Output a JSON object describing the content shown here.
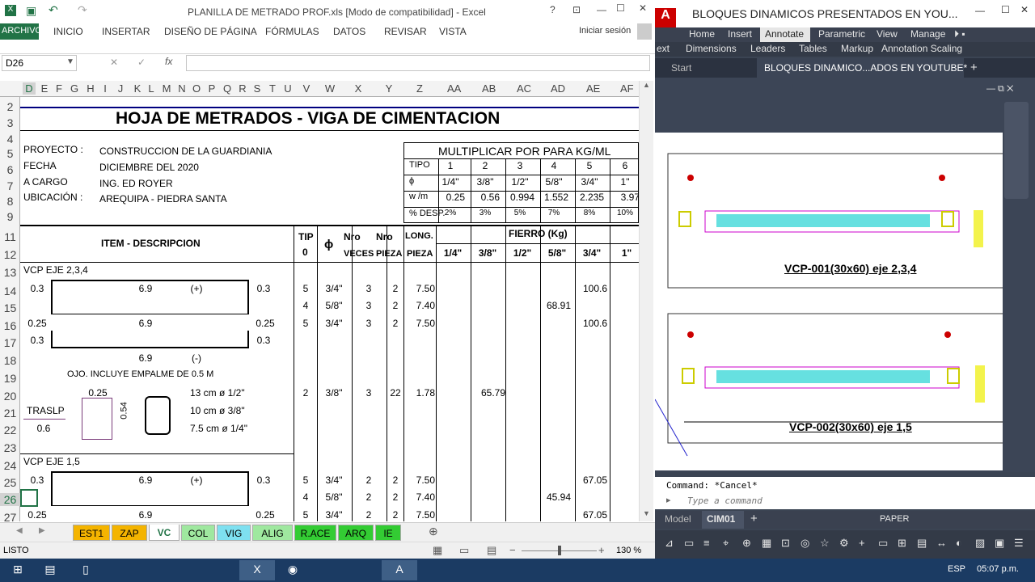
{
  "excel": {
    "title": "PLANILLA DE METRADO PROF.xls  [Modo de compatibilidad] - Excel",
    "tabs": [
      "ARCHIVO",
      "INICIO",
      "INSERTAR",
      "DISEÑO DE PÁGINA",
      "FÓRMULAS",
      "DATOS",
      "REVISAR",
      "VISTA"
    ],
    "signin": "Iniciar sesión",
    "namebox": "D26",
    "columns": [
      "D",
      "E",
      "F",
      "G",
      "H",
      "I",
      "J",
      "K",
      "L",
      "M",
      "N",
      "O",
      "P",
      "Q",
      "R",
      "S",
      "T",
      "U",
      "V",
      "W",
      "X",
      "Y",
      "Z",
      "AA",
      "AB",
      "AC",
      "AD",
      "AE",
      "AF"
    ],
    "rows": [
      "2",
      "3",
      "4",
      "5",
      "6",
      "7",
      "8",
      "9",
      "11",
      "12",
      "13",
      "14",
      "15",
      "16",
      "17",
      "18",
      "19",
      "20",
      "21",
      "22",
      "23",
      "24",
      "25",
      "26",
      "27"
    ],
    "sheet_title": "HOJA DE METRADOS - VIGA DE CIMENTACION",
    "info": {
      "labels": [
        "PROYECTO :",
        "FECHA",
        "A CARGO",
        "UBICACIÓN :"
      ],
      "values": [
        "CONSTRUCCION DE LA GUARDIANIA",
        "DICIEMBRE DEL 2020",
        "ING. ED ROYER",
        "AREQUIPA - PIEDRA SANTA"
      ]
    },
    "mult": {
      "title": "MULTIPLICAR POR PARA  KG/ML",
      "tipo_label": "TIPO",
      "tipos": [
        "1",
        "2",
        "3",
        "4",
        "5",
        "6"
      ],
      "phi_label": "ϕ",
      "phis": [
        "1/4\"",
        "3/8\"",
        "1/2\"",
        "5/8\"",
        "3/4\"",
        "1\""
      ],
      "wm_label": "w /m",
      "wm": [
        "0.25",
        "0.56",
        "0.994",
        "1.552",
        "2.235",
        "3.97"
      ],
      "desp_label": "% DESP.",
      "desp": [
        "2%",
        "3%",
        "5%",
        "7%",
        "8%",
        "10%"
      ]
    },
    "head": {
      "item": "ITEM - DESCRIPCION",
      "tip": "TIP",
      "tip0": "0",
      "phi": "ϕ",
      "nro1": "Nro",
      "veces": "VECES",
      "nro2": "Nro",
      "pieza": "PIEZA",
      "long": "LONG.",
      "piezal": "PIEZA",
      "fierro": "FIERRO (Kg)",
      "bars": [
        "1/4\"",
        "3/8\"",
        "1/2\"",
        "5/8\"",
        "3/4\"",
        "1\""
      ]
    },
    "body": {
      "r13": "VCP EJE 2,3,4",
      "r14": [
        "0.3",
        "6.9",
        "(+)",
        "0.3",
        "5",
        "3/4\"",
        "3",
        "2",
        "7.50",
        "100.6"
      ],
      "r15": [
        "4",
        "5/8\"",
        "3",
        "2",
        "7.40",
        "68.91"
      ],
      "r16": [
        "0.25",
        "6.9",
        "0.25",
        "5",
        "3/4\"",
        "3",
        "2",
        "7.50",
        "100.6"
      ],
      "r17": [
        "0.3",
        "0.3"
      ],
      "r18": [
        "6.9",
        "(-)"
      ],
      "r19": "OJO. INCLUYE EMPALME DE 0.5 M",
      "r20": [
        "0.25",
        "13 cm  ø 1/2\"",
        "2",
        "3/8\"",
        "3",
        "22",
        "1.78",
        "65.79"
      ],
      "r21": [
        "TRASLP",
        "0.54",
        "10 cm  ø 3/8\""
      ],
      "r22": [
        "0.6",
        "7.5 cm  ø 1/4\""
      ],
      "r24": "VCP EJE 1,5",
      "r25": [
        "0.3",
        "6.9",
        "(+)",
        "0.3",
        "5",
        "3/4\"",
        "2",
        "2",
        "7.50",
        "67.05"
      ],
      "r26": [
        "4",
        "5/8\"",
        "2",
        "2",
        "7.40",
        "45.94"
      ],
      "r27": [
        "0.25",
        "6.9",
        "0.25",
        "5",
        "3/4\"",
        "2",
        "2",
        "7.50",
        "67.05"
      ]
    },
    "sheets": [
      "EST1",
      "ZAP",
      "VC",
      "COL",
      "VIG",
      "ALIG",
      "R.ACE",
      "ARQ",
      "IE"
    ],
    "status": "LISTO",
    "zoom": "130 %"
  },
  "autocad": {
    "title": "BLOQUES DINAMICOS PRESENTADOS EN YOU...",
    "tabs": [
      "Home",
      "Insert",
      "Annotate",
      "Parametric",
      "View",
      "Manage"
    ],
    "panels": [
      "ext",
      "Dimensions",
      "Leaders",
      "Tables",
      "Markup",
      "Annotation Scaling"
    ],
    "doctabs": [
      "Start",
      "BLOQUES DINAMICO...ADOS EN YOUTUBE*"
    ],
    "label1": "VCP-001(30x60) eje 2,3,4",
    "label2": "VCP-002(30x60) eje 1,5",
    "cmd_history": "Command: *Cancel*",
    "cmd_placeholder": "Type a command",
    "layouts": [
      "Model",
      "CIM01"
    ],
    "paper": "PAPER"
  },
  "taskbar": {
    "lang": "ESP",
    "time": "05:07 p.m."
  }
}
